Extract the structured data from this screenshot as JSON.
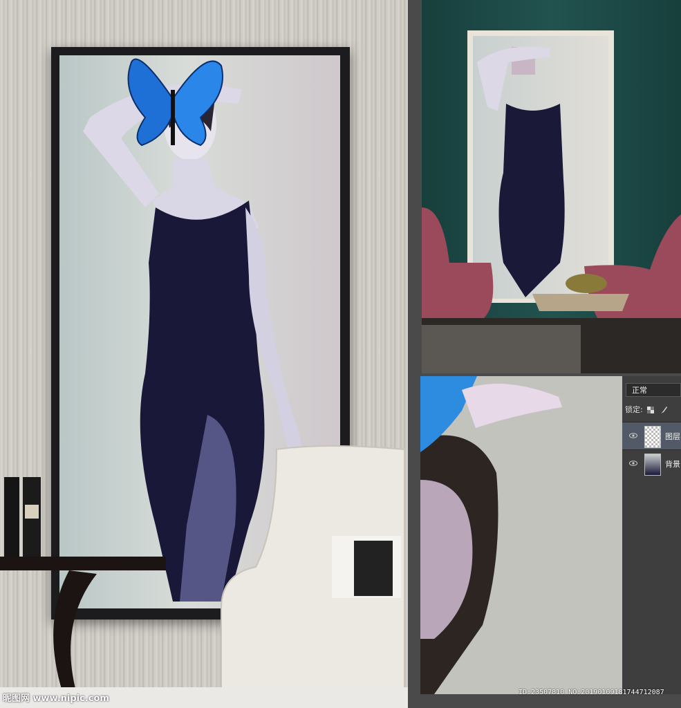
{
  "watermark": "昵图网 www.nipic.com",
  "id_text": "ID:23507810 NO:20190109181744712087",
  "layers_panel": {
    "blend_mode": "正常",
    "lock_label": "锁定:",
    "layers": [
      {
        "name": "图层",
        "selected": true
      },
      {
        "name": "背景",
        "selected": false
      }
    ]
  },
  "icons": {
    "visibility": "eye-icon",
    "lock_transparency": "checkerboard-icon",
    "lock_paint": "brush-icon"
  }
}
